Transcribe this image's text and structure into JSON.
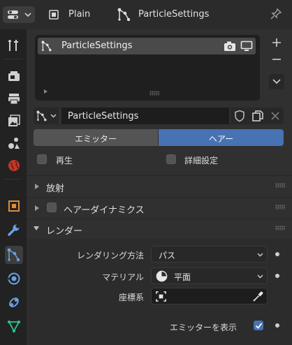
{
  "header": {
    "view_mode": "Plain",
    "context_name": "ParticleSettings"
  },
  "list": {
    "items": [
      {
        "name": "ParticleSettings",
        "selected": true
      }
    ]
  },
  "datablock": {
    "name": "ParticleSettings"
  },
  "type_toggle": {
    "options": [
      "エミッター",
      "ヘアー"
    ],
    "selected": "ヘアー"
  },
  "checkboxes": {
    "play_label": "再生",
    "play_checked": false,
    "advanced_label": "詳細設定",
    "advanced_checked": false
  },
  "panels": {
    "emission": {
      "label": "放射",
      "expanded": false
    },
    "hair_dynamics": {
      "label": "ヘアーダイナミクス",
      "expanded": false,
      "checked": false
    },
    "render": {
      "label": "レンダー",
      "expanded": true
    }
  },
  "render": {
    "method_label": "レンダリング方法",
    "method_value": "パス",
    "material_label": "マテリアル",
    "material_value": "平面",
    "coords_label": "座標系",
    "coords_value": "",
    "show_emitter_label": "エミッターを表示",
    "show_emitter_checked": true
  },
  "colors": {
    "accent": "#4772b3",
    "panel_bg": "#303030",
    "sidebar_bg": "#222222",
    "header_bg": "#2b2b2b",
    "field_bg": "#1d1d1d"
  },
  "icons": {
    "editor_type": "properties-editor-icon",
    "pin": "pin-icon",
    "particles": "particles-icon",
    "camera": "camera-icon",
    "monitor": "monitor-icon",
    "add": "plus-icon",
    "remove": "minus-icon",
    "menu": "chevron-down-icon",
    "fake_user": "shield-icon",
    "duplicate": "duplicate-icon",
    "unlink": "close-icon",
    "material": "material-sphere-icon",
    "eyedropper": "eyedropper-icon",
    "object": "object-icon"
  }
}
